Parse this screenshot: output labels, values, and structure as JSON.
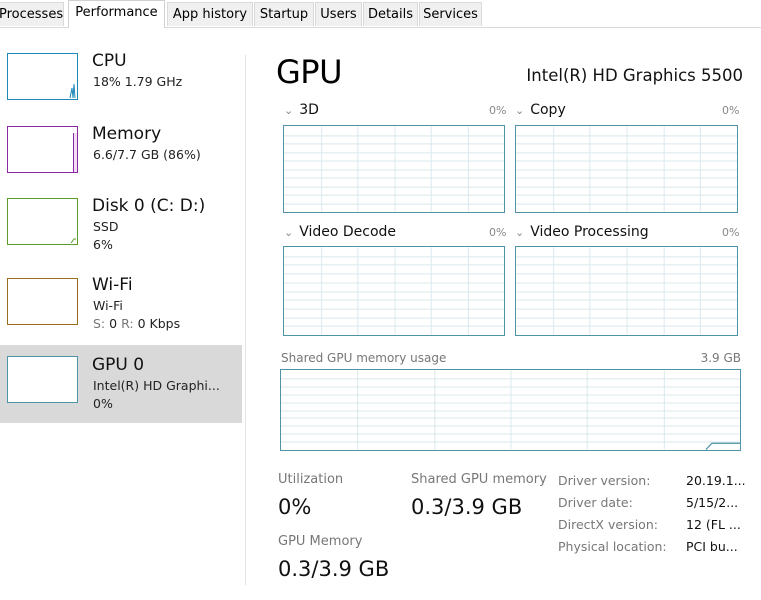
{
  "tabs": [
    {
      "label": "Processes",
      "active": false
    },
    {
      "label": "Performance",
      "active": true
    },
    {
      "label": "App history",
      "active": false
    },
    {
      "label": "Startup",
      "active": false
    },
    {
      "label": "Users",
      "active": false
    },
    {
      "label": "Details",
      "active": false
    },
    {
      "label": "Services",
      "active": false
    }
  ],
  "sidebar": {
    "items": [
      {
        "title": "CPU",
        "line1": "18%  1.79 GHz",
        "line2": "",
        "color": "#1c88b8",
        "selected": false,
        "usage_pct": 18
      },
      {
        "title": "Memory",
        "line1": "6.6/7.7 GB (86%)",
        "line2": "",
        "color": "#8b27a0",
        "selected": false,
        "usage_pct": 86
      },
      {
        "title": "Disk 0 (C: D:)",
        "line1": "SSD",
        "line2": "6%",
        "color": "#5e9c2a",
        "selected": false,
        "usage_pct": 6
      },
      {
        "title": "Wi-Fi",
        "line1": "Wi-Fi",
        "line2_s_label": "S:",
        "line2_s_value": "0",
        "line2_r_label": "R:",
        "line2_r_value": "0 Kbps",
        "color": "#9a6d1e",
        "selected": false
      },
      {
        "title": "GPU 0",
        "line1": "Intel(R) HD Graphi...",
        "line2": "0%",
        "color": "#4e93a8",
        "selected": true,
        "usage_pct": 0
      }
    ]
  },
  "main": {
    "title": "GPU",
    "model": "Intel(R) HD Graphics 5500",
    "accent": "#4e93a8",
    "engines": [
      {
        "label": "3D",
        "pct": "0%"
      },
      {
        "label": "Copy",
        "pct": "0%"
      },
      {
        "label": "Video Decode",
        "pct": "0%"
      },
      {
        "label": "Video Processing",
        "pct": "0%"
      }
    ],
    "shared_memory_graph": {
      "label": "Shared GPU memory usage",
      "max": "3.9 GB",
      "current_fraction": 0.08
    },
    "stats": {
      "utilization_label": "Utilization",
      "utilization_value": "0%",
      "shared_mem_label": "Shared GPU memory",
      "shared_mem_value": "0.3/3.9 GB",
      "gpu_mem_label": "GPU Memory",
      "gpu_mem_value": "0.3/3.9 GB"
    },
    "details": [
      {
        "key": "Driver version:",
        "value": "20.19.1..."
      },
      {
        "key": "Driver date:",
        "value": "5/15/2..."
      },
      {
        "key": "DirectX version:",
        "value": "12 (FL ..."
      },
      {
        "key": "Physical location:",
        "value": "PCI bu..."
      }
    ]
  }
}
